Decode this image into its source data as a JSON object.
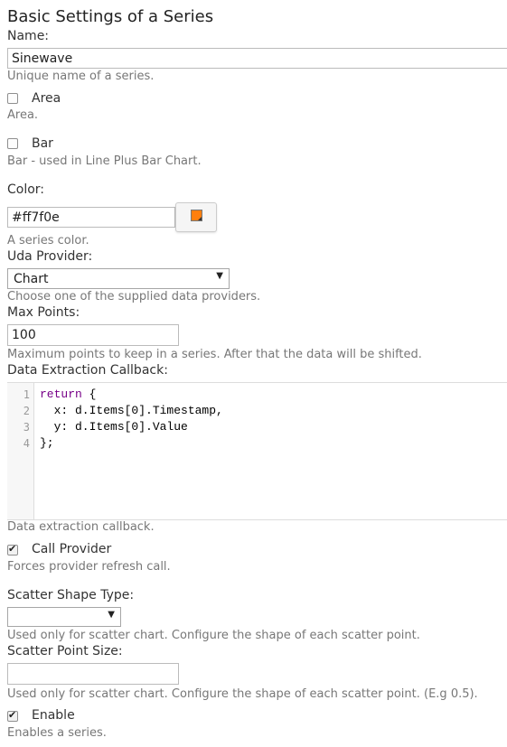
{
  "title": "Basic Settings of a Series",
  "name": {
    "label": "Name:",
    "value": "Sinewave",
    "help": "Unique name of a series."
  },
  "area": {
    "label": "Area",
    "checked": false,
    "help": "Area."
  },
  "bar": {
    "label": "Bar",
    "checked": false,
    "help": "Bar - used in Line Plus Bar Chart."
  },
  "color": {
    "label": "Color:",
    "value": "#ff7f0e",
    "swatch": "#ff7f0e",
    "help": "A series color."
  },
  "uda_provider": {
    "label": "Uda Provider:",
    "selected": "Chart",
    "help": "Choose one of the supplied data providers."
  },
  "max_points": {
    "label": "Max Points:",
    "value": "100",
    "help": "Maximum points to keep in a series. After that the data will be shifted."
  },
  "callback": {
    "label": "Data Extraction Callback:",
    "line_numbers": [
      "1",
      "2",
      "3",
      "4"
    ],
    "lines": [
      "return {",
      "  x: d.Items[0].Timestamp,",
      "  y: d.Items[0].Value",
      "};"
    ],
    "help": "Data extraction callback."
  },
  "call_provider": {
    "label": "Call Provider",
    "checked": true,
    "help": "Forces provider refresh call."
  },
  "scatter_shape": {
    "label": "Scatter Shape Type:",
    "selected": "",
    "help": "Used only for scatter chart. Configure the shape of each scatter point."
  },
  "scatter_size": {
    "label": "Scatter Point Size:",
    "value": "",
    "help": "Used only for scatter chart. Configure the shape of each scatter point. (E.g 0.5)."
  },
  "enable": {
    "label": "Enable",
    "checked": true,
    "help": "Enables a series."
  },
  "icons": {
    "dropdown": "triangle-down",
    "check": "check-mark"
  }
}
